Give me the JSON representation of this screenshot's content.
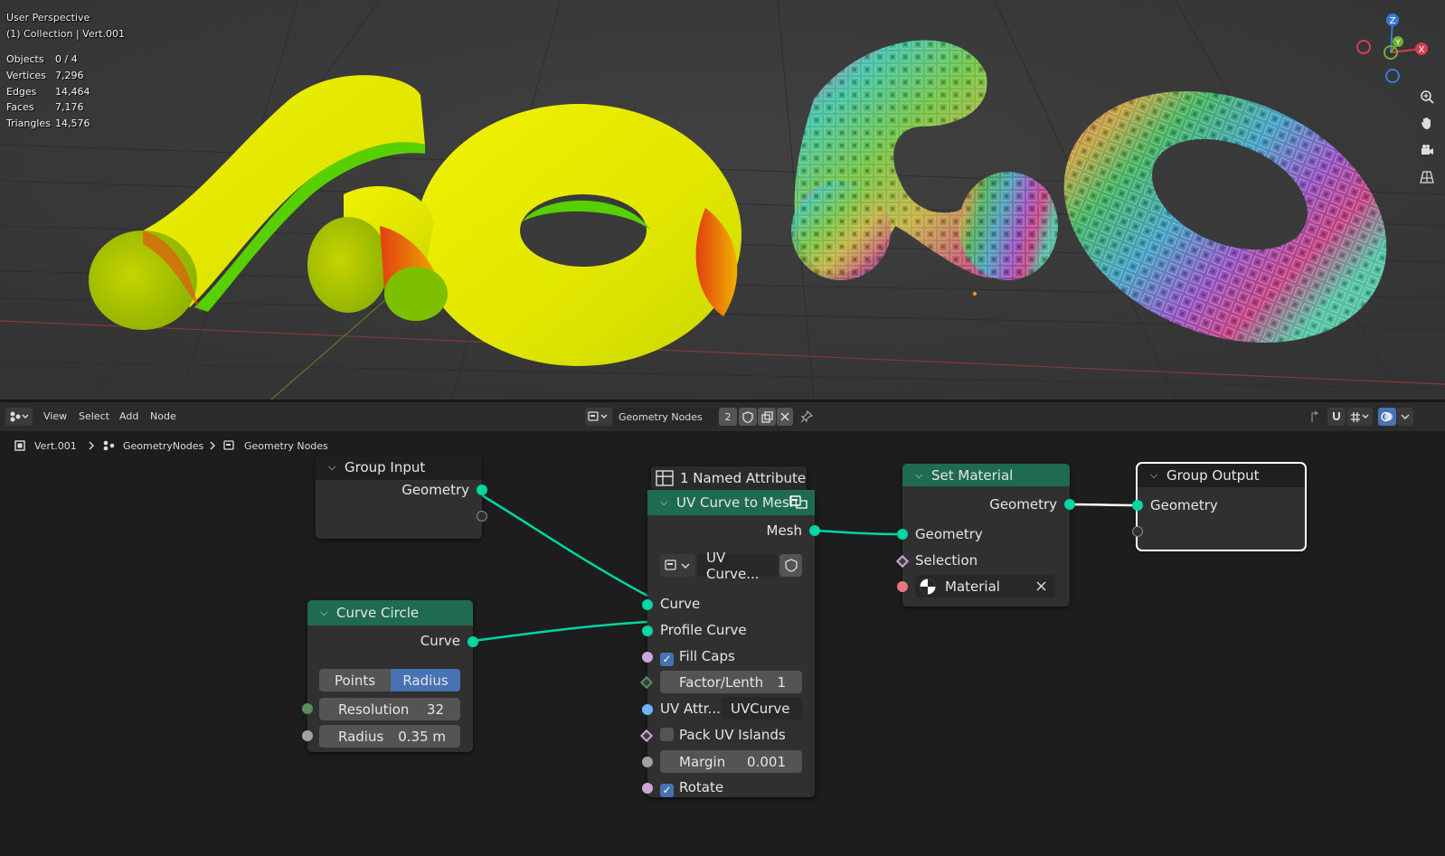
{
  "viewport": {
    "view_name": "User Perspective",
    "collection_info": "(1) Collection | Vert.001",
    "stats": [
      {
        "label": "Objects",
        "value": "0 / 4"
      },
      {
        "label": "Vertices",
        "value": "7,296"
      },
      {
        "label": "Edges",
        "value": "14,464"
      },
      {
        "label": "Faces",
        "value": "7,176"
      },
      {
        "label": "Triangles",
        "value": "14,576"
      }
    ],
    "gizmo": {
      "z": "Z",
      "y": "Y",
      "x": "X"
    }
  },
  "header": {
    "menus": [
      "View",
      "Select",
      "Add",
      "Node"
    ],
    "node_tree_name": "Geometry Nodes",
    "user_count": "2"
  },
  "breadcrumb": {
    "object": "Vert.001",
    "modifier": "GeometryNodes",
    "tree": "Geometry Nodes"
  },
  "nodes": {
    "group_input": {
      "title": "Group Input",
      "out_geometry": "Geometry"
    },
    "curve_circle": {
      "title": "Curve Circle",
      "out_curve": "Curve",
      "mode_points": "Points",
      "mode_radius": "Radius",
      "resolution_label": "Resolution",
      "resolution_value": "32",
      "radius_label": "Radius",
      "radius_value": "0.35 m"
    },
    "named_attr": {
      "label": "1 Named Attribute"
    },
    "uv_curve": {
      "title": "UV Curve to Mesh",
      "out_mesh": "Mesh",
      "group_name": "UV Curve...",
      "in_curve": "Curve",
      "in_profile": "Profile Curve",
      "fill_caps": "Fill Caps",
      "factor_label": "Factor/Lenth",
      "factor_value": "1",
      "uv_attr_label": "UV Attr...",
      "uv_attr_value": "UVCurve",
      "pack_uv": "Pack UV Islands",
      "margin_label": "Margin",
      "margin_value": "0.001",
      "rotate": "Rotate"
    },
    "set_material": {
      "title": "Set Material",
      "out_geometry": "Geometry",
      "in_geometry": "Geometry",
      "in_selection": "Selection",
      "material": "Material"
    },
    "group_output": {
      "title": "Group Output",
      "in_geometry": "Geometry"
    }
  },
  "colors": {
    "geometry_socket": "#00d6a3",
    "float_socket": "#a1a1a1",
    "bool_socket": "#cca6d6",
    "vector_socket": "#6363c7",
    "int_socket": "#598c5c",
    "material_socket": "#eb7582",
    "string_socket": "#70b2ff",
    "geo_header": "#1e6a52",
    "selected_outline": "#ffffff",
    "active_button": "#4772b3"
  }
}
